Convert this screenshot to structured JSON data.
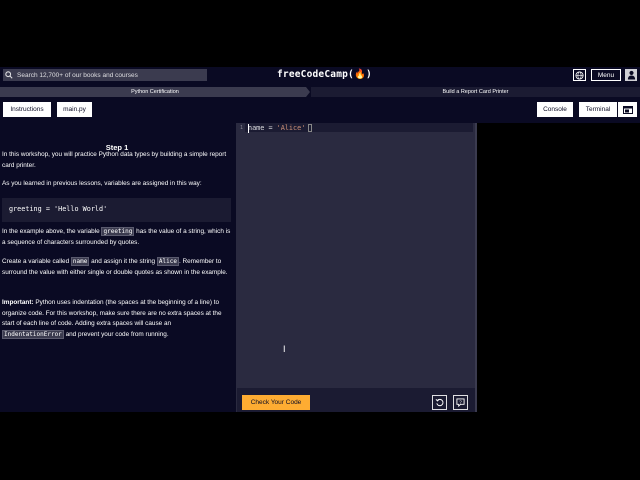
{
  "navbar": {
    "search_placeholder": "Search 12,700+ of our books and courses",
    "logo": "freeCodeCamp(🔥)",
    "menu_label": "Menu"
  },
  "breadcrumb": {
    "items": [
      "Python Certification",
      "Build a Report Card Printer"
    ]
  },
  "toolbar": {
    "tabs": [
      "Instructions",
      "main.py"
    ],
    "console_label": "Console",
    "terminal_label": "Terminal"
  },
  "instructions": {
    "step_title": "Step 1",
    "p1": "In this workshop, you will practice Python data types by building a simple report card printer.",
    "p2": "As you learned in previous lessons, variables are assigned in this way:",
    "code_example": "greeting = 'Hello World'",
    "p3_a": "In the example above, the variable ",
    "p3_code": "greeting",
    "p3_b": " has the value of a string, which is a sequence of characters surrounded by quotes.",
    "p4_a": "Create a variable called ",
    "p4_code1": "name",
    "p4_b": " and assign it the string ",
    "p4_code2": "Alice",
    "p4_c": ". Remember to surround the value with either single or double quotes as shown in the example.",
    "p5_bold": "Important:",
    "p5_a": " Python uses indentation (the spaces at the beginning of a line) to organize code. For this workshop, make sure there are no extra spaces at the start of each line of code. Adding extra spaces will cause an ",
    "p5_code": "IndentationError",
    "p5_b": " and prevent your code from running."
  },
  "editor": {
    "line_number": "1",
    "code_var": "name = ",
    "code_str": "'Alice'"
  },
  "actions": {
    "check_label": "Check Your Code"
  },
  "colors": {
    "background": "#0a0a23",
    "accent": "#feac32"
  }
}
